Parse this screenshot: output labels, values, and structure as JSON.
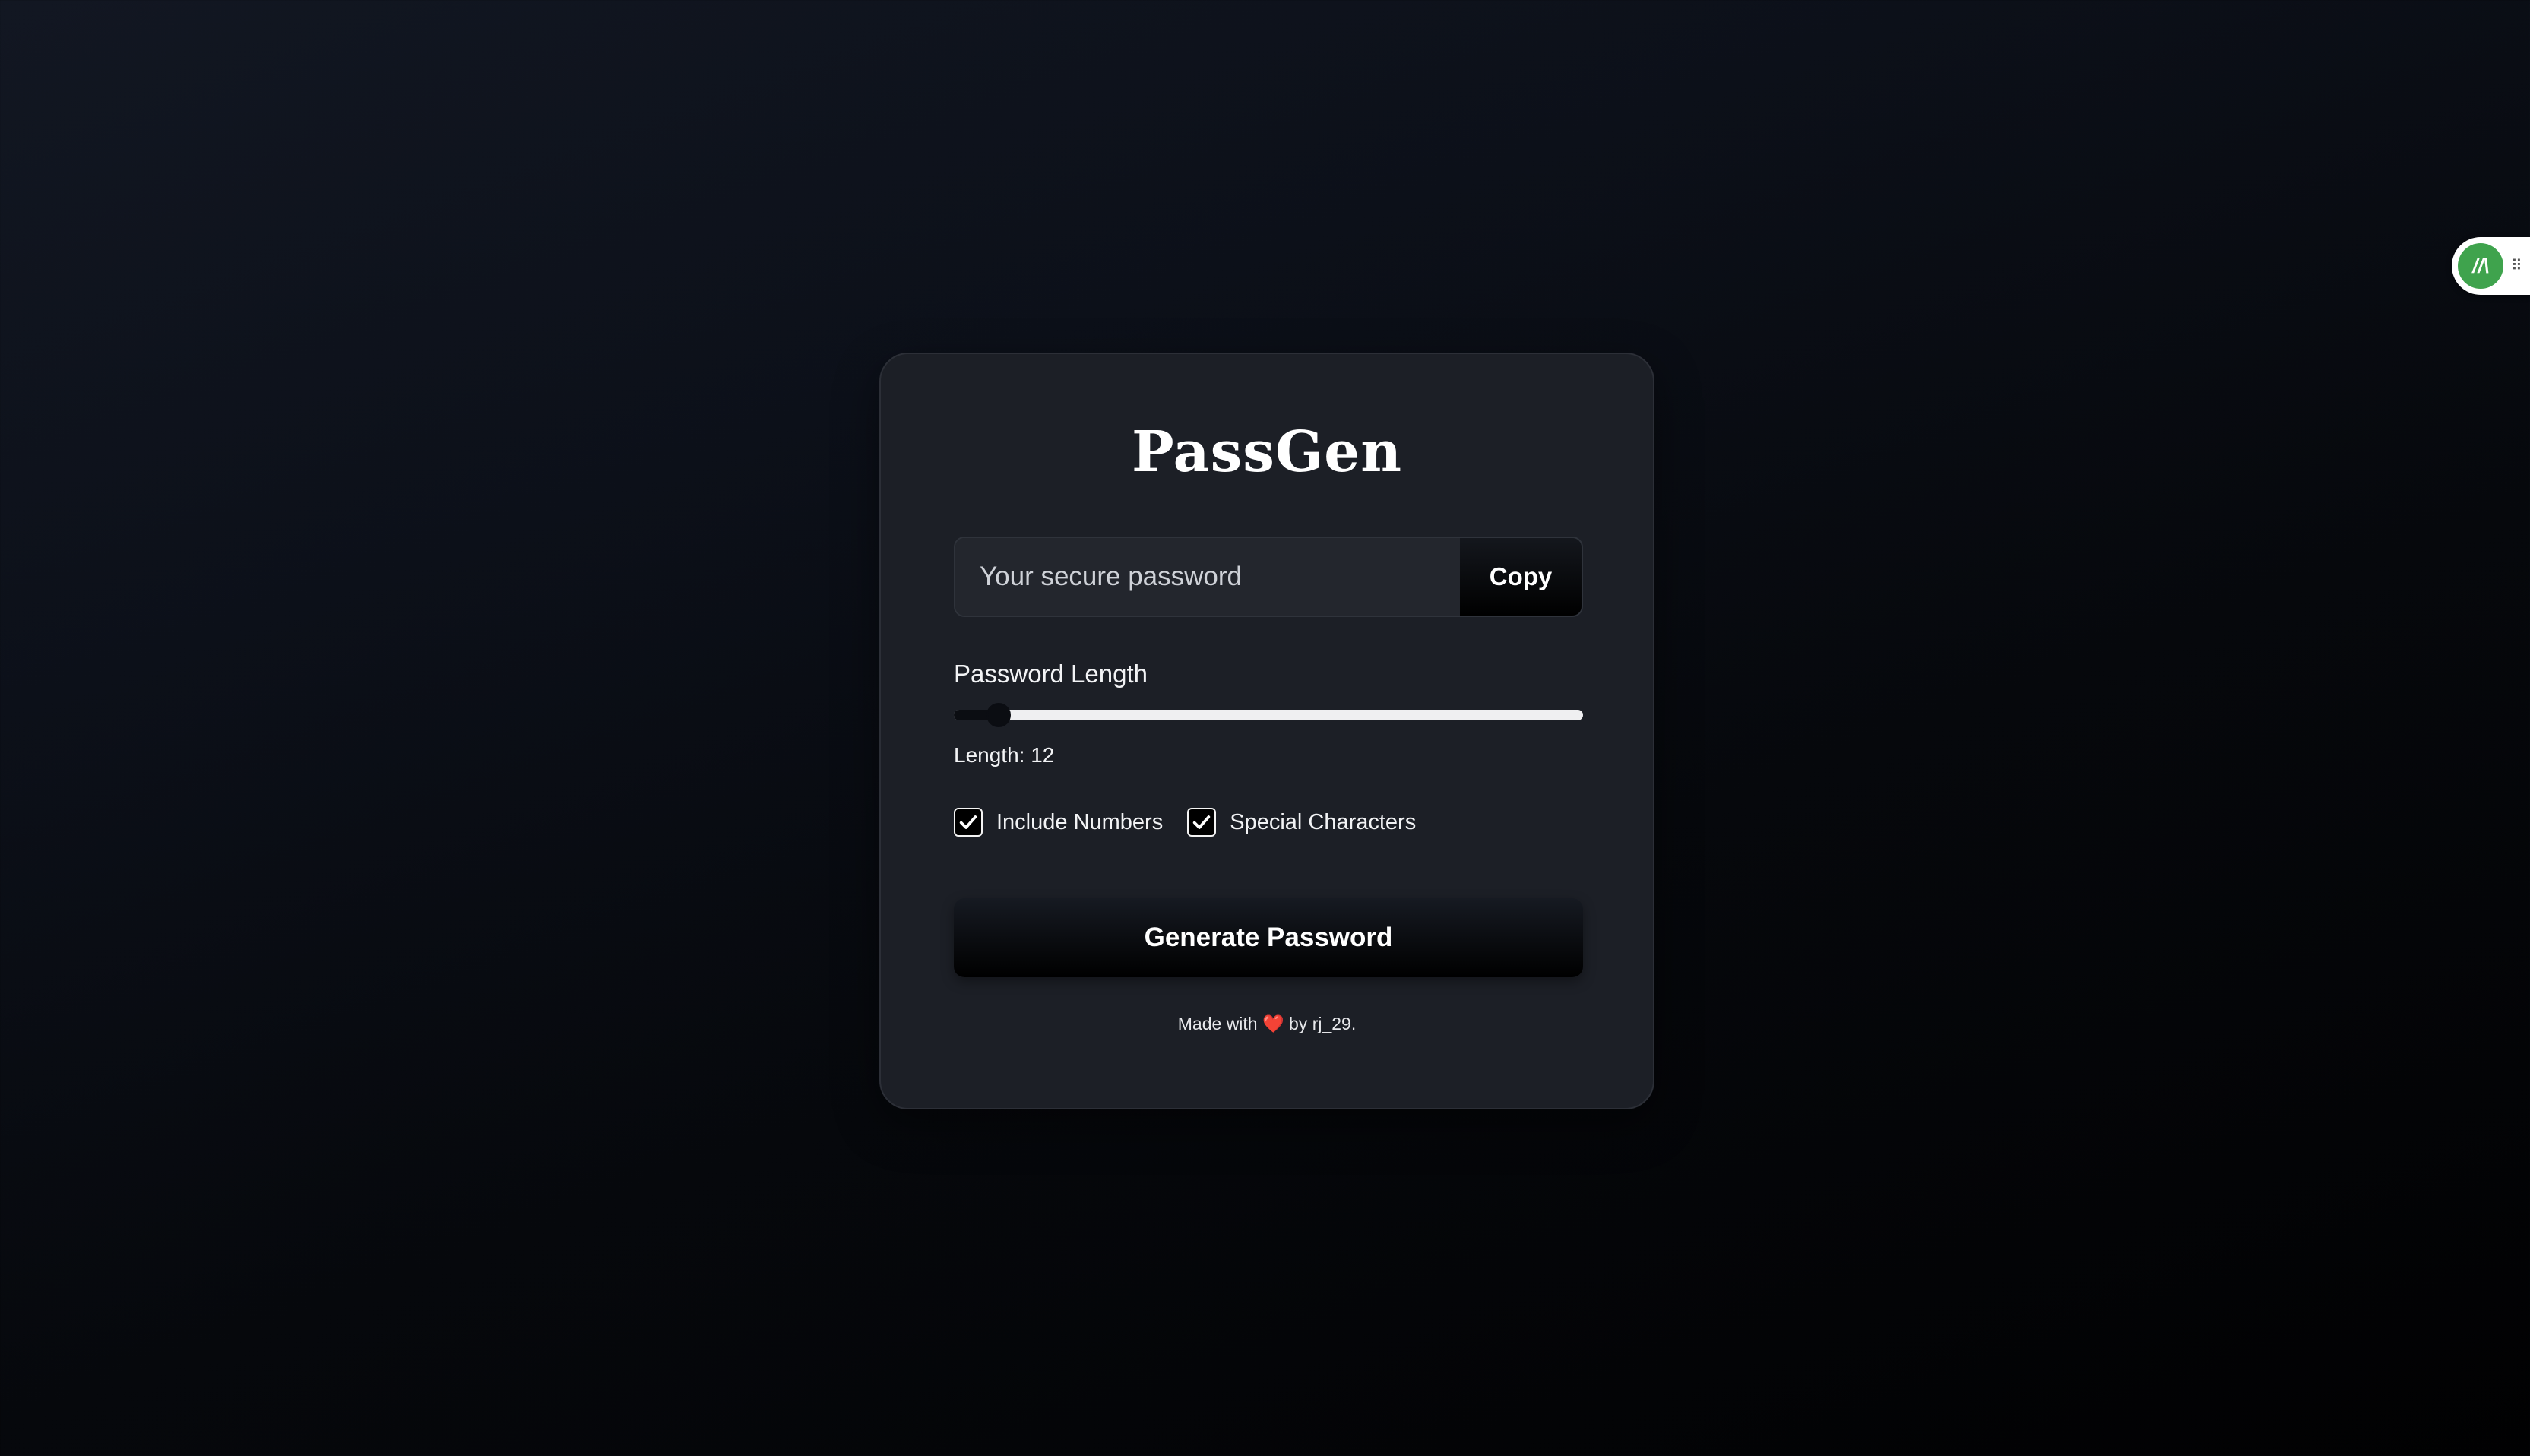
{
  "app": {
    "title": "PassGen"
  },
  "password": {
    "placeholder": "Your secure password",
    "value": "",
    "copy_label": "Copy"
  },
  "length": {
    "label": "Password Length",
    "value_text": "Length: 12",
    "min": 8,
    "max": 64,
    "value": 12
  },
  "options": [
    {
      "label": "Include Numbers",
      "checked": true
    },
    {
      "label": "Special Characters",
      "checked": true
    }
  ],
  "generate": {
    "label": "Generate Password"
  },
  "footer": {
    "before": "Made with",
    "heart": "❤️",
    "after": "by rj_29."
  },
  "extension_widget": {
    "logo_text": "//\\",
    "grip": "⠿"
  },
  "colors": {
    "card_bg": "#1c1f26",
    "accent": "#000000",
    "extension_green": "#3fa34d"
  }
}
